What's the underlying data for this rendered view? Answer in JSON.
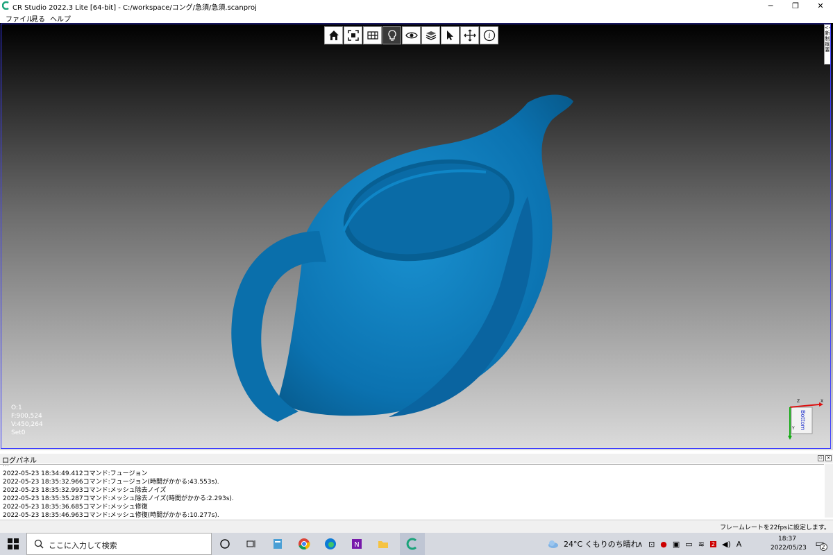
{
  "window": {
    "title": "CR Studio 2022.3 Lite [64-bit] - C:/workspace/コング/急須/急須.scanproj",
    "minimize_icon": "minimize-icon",
    "maximize_icon": "restore-icon",
    "close_icon": "close-icon"
  },
  "menu": [
    "ファイル",
    "見る",
    "ヘルプ"
  ],
  "toolbar": [
    {
      "icon": "home-icon"
    },
    {
      "icon": "fit-view-icon"
    },
    {
      "icon": "grid-view-icon"
    },
    {
      "icon": "light-bulb-icon",
      "active": true
    },
    {
      "icon": "eye-icon"
    },
    {
      "icon": "layers-icon"
    },
    {
      "icon": "select-cursor-icon"
    },
    {
      "icon": "move-icon"
    },
    {
      "icon": "info-icon"
    }
  ],
  "right_tab": {
    "label": "<< 新 制 概 要"
  },
  "viewport": {
    "mesh_color": "#0b77b7",
    "stats": [
      "O:1",
      "F:900,524",
      "V:450,264",
      "Set0"
    ],
    "axis": {
      "face_label": "Bottom",
      "x_label": "X",
      "y_label": "Y",
      "z_label": "Z"
    }
  },
  "log_panel": {
    "title": "ログパネル",
    "lines": [
      "2022-05-23 18:34:49.412コマンド:フュージョン",
      "2022-05-23 18:35:32.966コマンド:フュージョン(時間がかかる:43.553s).",
      "2022-05-23 18:35:32.993コマンド:メッシュ除去ノイズ",
      "2022-05-23 18:35:35.287コマンド:メッシュ除去ノイズ(時間がかかる:2.293s).",
      "2022-05-23 18:35:36.685コマンド:メッシュ修復",
      "2022-05-23 18:35:46.963コマンド:メッシュ修復(時間がかかる:10.277s)."
    ]
  },
  "status_bar": {
    "text": "フレームレートを22fpsに設定します。"
  },
  "taskbar": {
    "search_placeholder": "ここに入力して検索",
    "weather": "24°C くもりのち晴れ",
    "ime": "A",
    "time": "18:37",
    "date": "2022/05/23",
    "notification_count": "2"
  }
}
